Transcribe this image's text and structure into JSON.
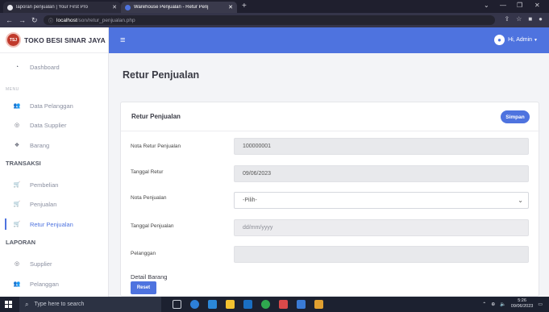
{
  "browser": {
    "tabs": [
      {
        "title": "laporan penjualan | Your First Pro",
        "active": false
      },
      {
        "title": "Warehouse Penjualan - Retur Penj",
        "active": true
      }
    ],
    "new_tab": "+",
    "url_host": "localhost",
    "url_path": "/son/retur_penjualan.php"
  },
  "sidebar": {
    "brand": "TOKO BESI SINAR JAYA",
    "dashboard": "Dashboard",
    "menu_head": "MENU",
    "menu_items": [
      "Data Pelanggan",
      "Data Supplier",
      "Barang"
    ],
    "transaksi_head": "TRANSAKSI",
    "transaksi_items": [
      "Pembelian",
      "Penjualan",
      "Retur Penjualan"
    ],
    "laporan_head": "LAPORAN",
    "laporan_items": [
      "Supplier",
      "Pelanggan"
    ]
  },
  "topbar": {
    "user_label": "Hi, Admin"
  },
  "page": {
    "title": "Retur Penjualan",
    "card_title": "Retur Penjualan",
    "save_label": "Simpan",
    "fields": {
      "nota_retur_label": "Nota Retur Penjualan",
      "nota_retur_value": "100000001",
      "tanggal_retur_label": "Tanggal Retur",
      "tanggal_retur_value": "09/06/2023",
      "nota_penjualan_label": "Nota Penjualan",
      "nota_penjualan_value": "-Pilih-",
      "tanggal_penjualan_label": "Tanggal Penjualan",
      "tanggal_penjualan_placeholder": "dd/mm/yyyy",
      "pelanggan_label": "Pelanggan",
      "pelanggan_value": ""
    },
    "detail_label": "Detail Barang",
    "reset_label": "Reset"
  },
  "taskbar": {
    "search_placeholder": "Type here to search",
    "time": "5:26",
    "date": "09/06/2023"
  },
  "colors": {
    "accent": "#4e73df",
    "sidebar_bg": "#ffffff",
    "taskbar_bg": "#1c2130"
  }
}
